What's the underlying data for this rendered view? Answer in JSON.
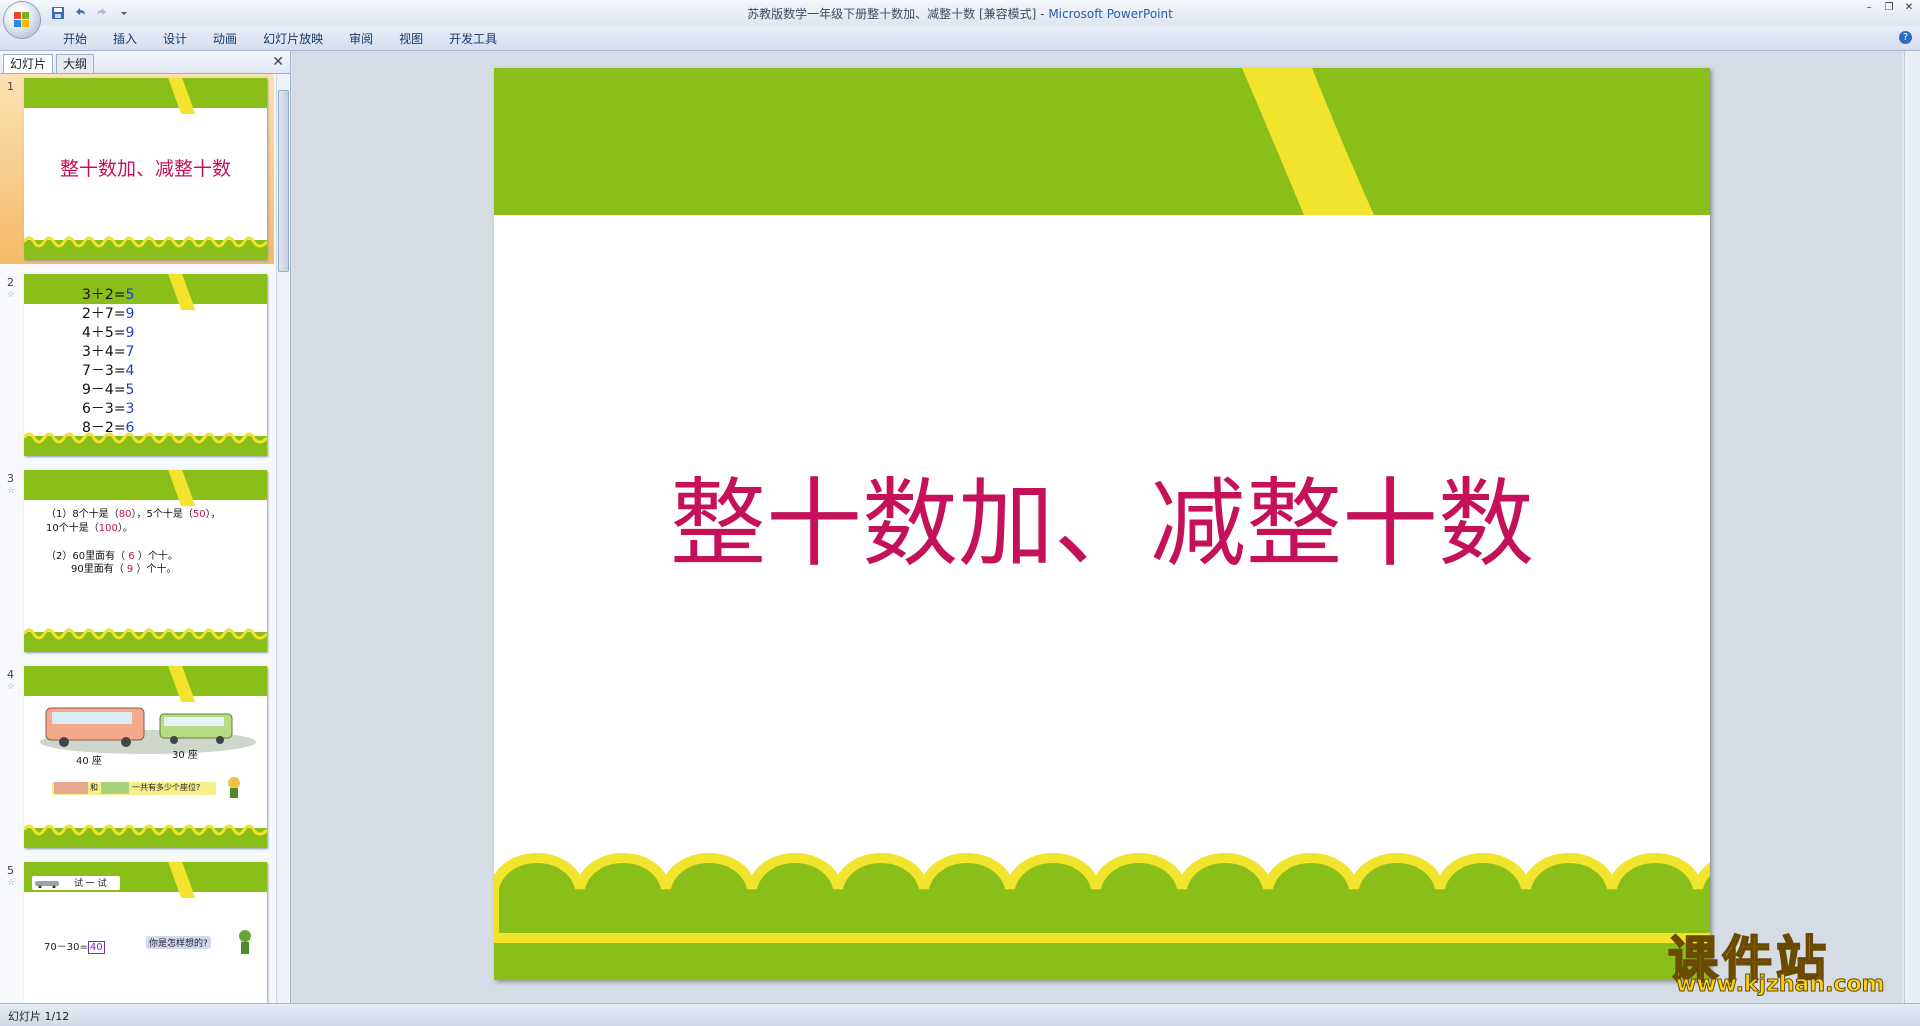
{
  "window": {
    "title_doc": "苏教版数学一年级下册整十数加、减整十数 [兼容模式]",
    "title_sep": " - ",
    "title_app": "Microsoft PowerPoint"
  },
  "quick_access": [
    "save-icon",
    "undo-icon",
    "redo-icon",
    "customize-icon"
  ],
  "ribbon": {
    "tabs": [
      "开始",
      "插入",
      "设计",
      "动画",
      "幻灯片放映",
      "审阅",
      "视图",
      "开发工具"
    ],
    "help": "?"
  },
  "left_pane": {
    "tab_slides": "幻灯片",
    "tab_outline": "大纲",
    "close": "✕"
  },
  "slides": [
    {
      "num": "1",
      "title": "整十数加、减整十数"
    },
    {
      "num": "2",
      "eq_left": [
        "3＋2=",
        "2＋7=",
        "4＋5=",
        "3＋4=",
        "7－3=",
        "9－4=",
        "6－3=",
        "8－2="
      ],
      "eq_right": [
        "5",
        "9",
        "9",
        "7",
        "4",
        "5",
        "3",
        "6"
      ]
    },
    {
      "num": "3",
      "line1a": "（1）8个十是（",
      "line1b": "80",
      "line1c": "），5个十是（",
      "line1d": "50",
      "line1e": "），",
      "line2a": "10个十是（",
      "line2b": "100",
      "line2c": "）。",
      "line3a": "（2）60里面有（ ",
      "line3b": "6",
      "line3c": " ）个十。",
      "line4a": "90里面有（ ",
      "line4b": "9",
      "line4c": " ）个十。"
    },
    {
      "num": "4",
      "label_a": "40 座",
      "label_b": "30 座",
      "banner_and": "和",
      "banner": "一共有多少个座位?"
    },
    {
      "num": "5",
      "badge": "试 一 试",
      "equation": "70－30=",
      "answer": "40",
      "bubble": "你是怎样想的?"
    }
  ],
  "main_slide": {
    "title": "整十数加、减整十数"
  },
  "status": {
    "slide_indicator": "幻灯片 1/12"
  },
  "watermark": {
    "brand": "课件站",
    "url": "www.kjzhan.com"
  },
  "colors": {
    "green": "#8abf1a",
    "yellow": "#f2e32c",
    "title_magenta": "#c4115a"
  }
}
